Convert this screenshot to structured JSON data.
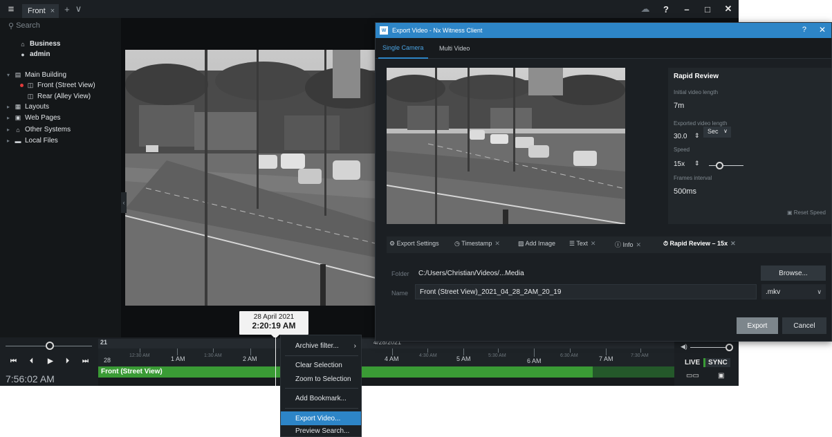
{
  "titlebar": {
    "tab_label": "Front",
    "tab_close": "×",
    "add_tab": "+",
    "tabs_menu": "∨",
    "help": "?",
    "minimize": "–",
    "maximize": "□",
    "close": "✕"
  },
  "sidebar": {
    "search_placeholder": "Search",
    "items": [
      {
        "label": "Business"
      },
      {
        "label": "admin"
      },
      {
        "label": "Main Building"
      },
      {
        "label": "Front (Street View)"
      },
      {
        "label": "Rear (Alley View)"
      },
      {
        "label": "Layouts"
      },
      {
        "label": "Web Pages"
      },
      {
        "label": "Other Systems"
      },
      {
        "label": "Local Files"
      }
    ]
  },
  "tooltip": {
    "date": "28 April 2021",
    "time": "2:20:19 AM"
  },
  "timeline": {
    "current_time": "7:56:02 AM",
    "day_top": "21",
    "day_bottom": "28",
    "date_label": "4/28/2021",
    "camera_label": "Front (Street View)",
    "hours": [
      {
        "label": "12:30 AM",
        "minor": true
      },
      {
        "label": "1 AM",
        "minor": false
      },
      {
        "label": "1:30 AM",
        "minor": true
      },
      {
        "label": "2 AM",
        "minor": false
      },
      {
        "label": "4 AM",
        "minor": false
      },
      {
        "label": "4:30 AM",
        "minor": true
      },
      {
        "label": "5 AM",
        "minor": false
      },
      {
        "label": "5:30 AM",
        "minor": true
      },
      {
        "label": "6 AM",
        "minor": false
      },
      {
        "label": "6:30 AM",
        "minor": true
      },
      {
        "label": "7 AM",
        "minor": false
      },
      {
        "label": "7:30 AM",
        "minor": true
      }
    ],
    "live_label": "LIVE",
    "sync_label": "SYNC"
  },
  "context_menu": {
    "archive_filter": "Archive filter...",
    "clear_selection": "Clear Selection",
    "zoom_to_selection": "Zoom to Selection",
    "add_bookmark": "Add Bookmark...",
    "export_video": "Export Video...",
    "preview_search": "Preview Search..."
  },
  "dialog": {
    "title": "Export Video - Nx Witness Client",
    "help": "?",
    "close": "✕",
    "tabs": [
      "Single Camera",
      "Multi Video"
    ],
    "panel": {
      "heading": "Rapid Review",
      "initial_label": "Initial video length",
      "initial_value": "7m",
      "exported_label": "Exported video length",
      "exported_value": "30.0",
      "unit": "Sec",
      "speed_label": "Speed",
      "speed_value": "15x",
      "frames_label": "Frames interval",
      "frames_value": "500ms",
      "reset": "Reset Speed"
    },
    "chips": [
      "Export Settings",
      "Timestamp",
      "Add Image",
      "Text",
      "Info",
      "Rapid Review – 15x"
    ],
    "folder_label": "Folder",
    "folder_value": "C:/Users/Christian/Videos/...Media",
    "browse": "Browse...",
    "name_label": "Name",
    "name_value": "Front (Street View)_2021_04_28_2AM_20_19",
    "extension": ".mkv",
    "export_button": "Export",
    "cancel_button": "Cancel"
  },
  "colors": {
    "accent": "#2d85c7",
    "timeline_green": "#3a9b35",
    "recording_red": "#e23b3b"
  }
}
